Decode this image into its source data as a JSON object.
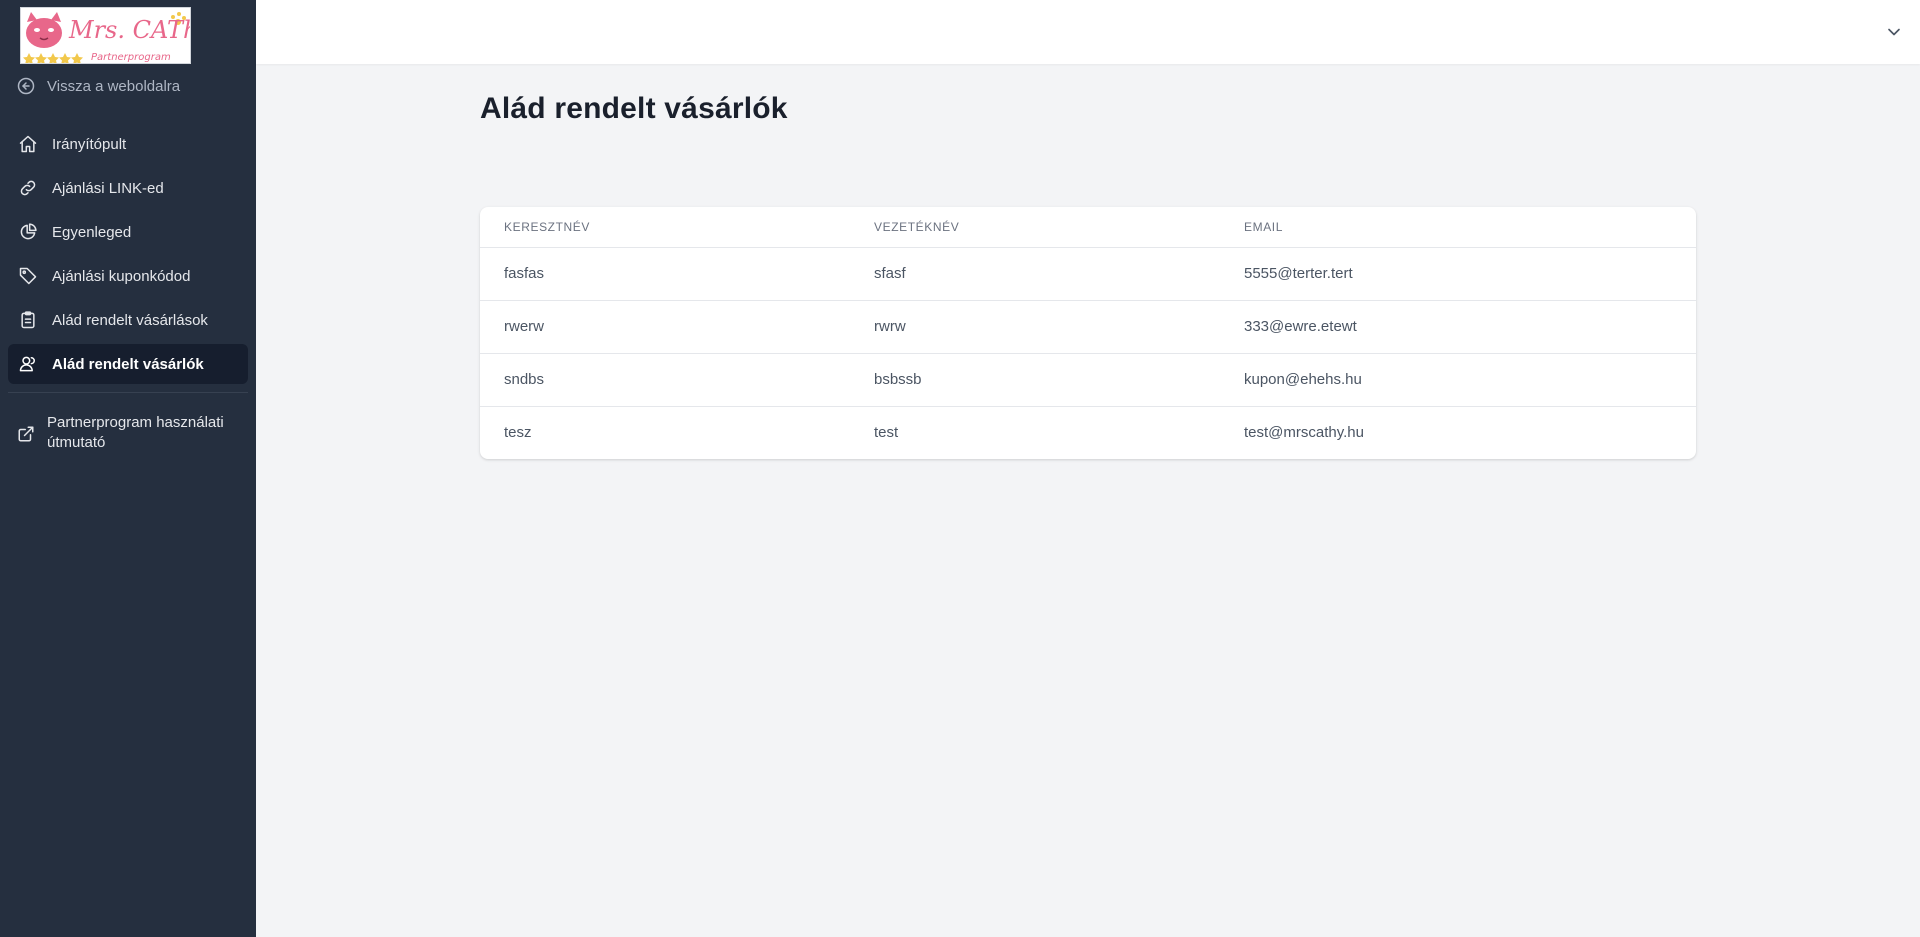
{
  "sidebar": {
    "logo": {
      "brand": "Mrs. CAThy",
      "subtitle": "Partnerprogram"
    },
    "back_label": "Vissza a weboldalra",
    "items": [
      {
        "label": "Irányítópult",
        "icon": "home-icon",
        "active": false
      },
      {
        "label": "Ajánlási LINK-ed",
        "icon": "link-icon",
        "active": false
      },
      {
        "label": "Egyenleged",
        "icon": "pie-chart-icon",
        "active": false
      },
      {
        "label": "Ajánlási kuponkódod",
        "icon": "tag-icon",
        "active": false
      },
      {
        "label": "Alád rendelt vásárlások",
        "icon": "clipboard-icon",
        "active": false
      },
      {
        "label": "Alád rendelt vásárlók",
        "icon": "users-icon",
        "active": true
      }
    ],
    "guide_label": "Partnerprogram használati útmutató"
  },
  "header": {
    "menu_icon": "chevron-down-icon"
  },
  "main": {
    "title": "Alád rendelt vásárlók",
    "table": {
      "columns": [
        "Keresztnév",
        "Vezetéknév",
        "Email"
      ],
      "rows": [
        [
          "fasfas",
          "sfasf",
          "5555@terter.tert"
        ],
        [
          "rwerw",
          "rwrw",
          "333@ewre.etewt"
        ],
        [
          "sndbs",
          "bsbssb",
          "kupon@ehehs.hu"
        ],
        [
          "tesz",
          "test",
          "test@mrscathy.hu"
        ]
      ]
    }
  },
  "colors": {
    "sidebar_bg": "#252f3f",
    "sidebar_active_bg": "#161e2e",
    "page_bg": "#f3f4f6",
    "logo_pink": "#e8678a",
    "star_gold": "#f2c84b"
  }
}
